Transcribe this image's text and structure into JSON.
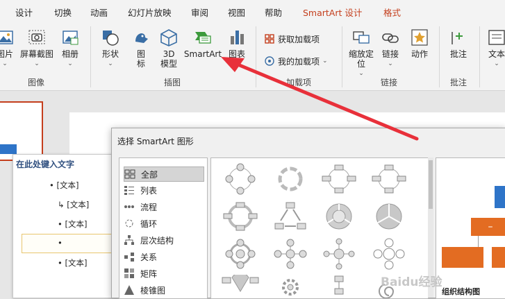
{
  "ribbon_tabs": [
    "设计",
    "切换",
    "动画",
    "幻灯片放映",
    "审阅",
    "视图",
    "帮助",
    "SmartArt 设计",
    "格式"
  ],
  "groups": {
    "image": {
      "label": "图像",
      "buttons": [
        {
          "label": "图片",
          "caret": "⌄"
        },
        {
          "label": "屏幕截图",
          "caret": "⌄"
        },
        {
          "label": "相册",
          "caret": "⌄"
        }
      ]
    },
    "illustration": {
      "label": "插图",
      "shapes": "形状",
      "shapes_caret": "⌄",
      "icons": "图标",
      "model3d": "3D 模型",
      "smartart": "SmartArt",
      "chart": "图表"
    },
    "addins": {
      "label": "加载项",
      "get": "获取加载项",
      "mine": "我的加载项",
      "mine_caret": "⌄"
    },
    "links": {
      "label": "链接",
      "zoom": "缩放定位",
      "zoom_caret": "⌄",
      "link": "链接",
      "link_caret": "⌄",
      "action": "动作"
    },
    "comments": {
      "label": "批注",
      "button": "批注"
    },
    "text": {
      "button": "文本",
      "caret": "⌄"
    }
  },
  "text_pane": {
    "title": "在此处键入文字",
    "items": [
      "[文本]",
      "[文本]",
      "[文本]",
      "",
      "[文本]"
    ]
  },
  "dialog": {
    "title": "选择 SmartArt 图形",
    "categories": [
      "全部",
      "列表",
      "流程",
      "循环",
      "层次结构",
      "关系",
      "矩阵",
      "棱锥图"
    ],
    "selected_category": "全部",
    "node_glyph": "–",
    "preview_caption": "组织结构图"
  },
  "colors": {
    "accent": "#c43e1c",
    "orange": "#e36c22",
    "blue": "#2e74c8"
  },
  "watermark": "Baidu经验"
}
